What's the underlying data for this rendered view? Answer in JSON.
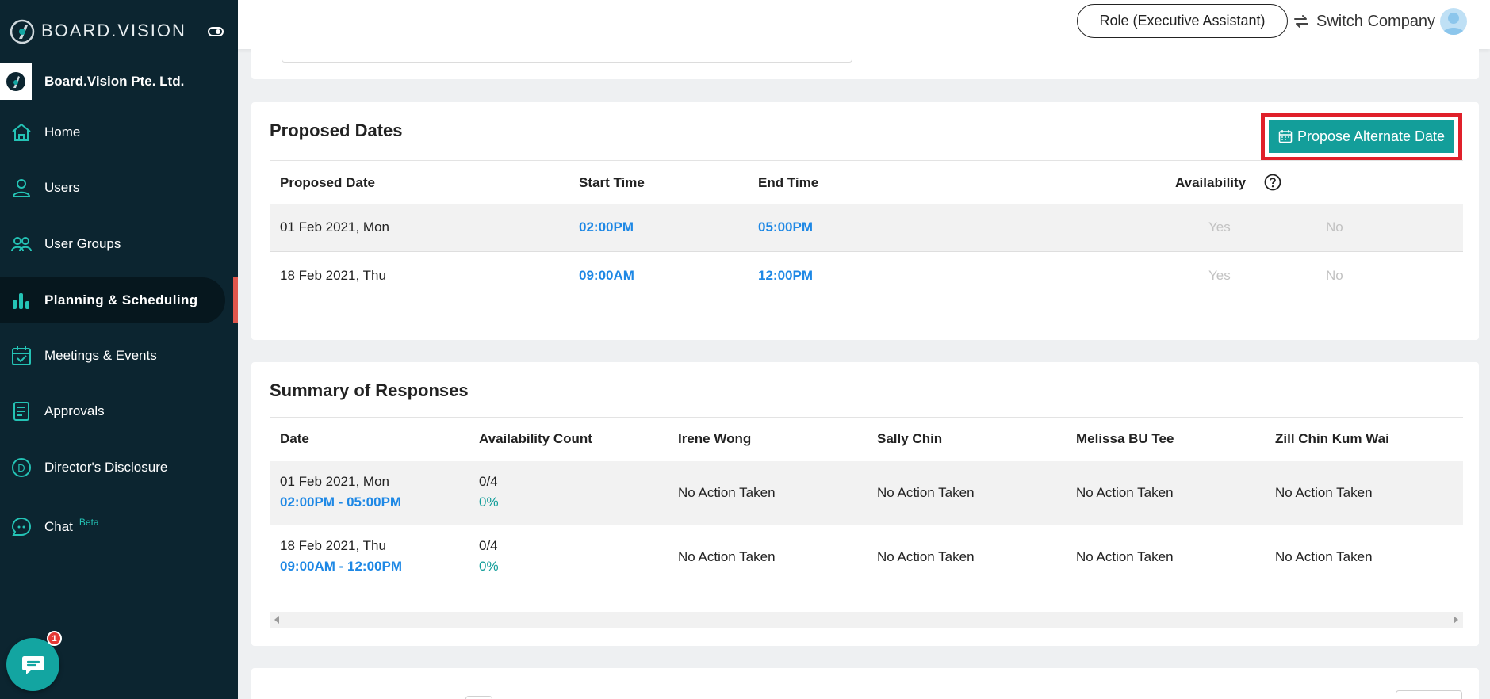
{
  "brand": {
    "name": "BOARD.VISION"
  },
  "company": {
    "name": "Board.Vision Pte. Ltd."
  },
  "sidebar": {
    "items": [
      {
        "label": "Home",
        "icon": "home-icon"
      },
      {
        "label": "Users",
        "icon": "user-icon"
      },
      {
        "label": "User Groups",
        "icon": "users-icon"
      },
      {
        "label": "Planning & Scheduling",
        "icon": "bar-chart-icon",
        "active": true
      },
      {
        "label": "Meetings & Events",
        "icon": "calendar-check-icon"
      },
      {
        "label": "Approvals",
        "icon": "document-icon"
      },
      {
        "label": "Director's Disclosure",
        "icon": "disclosure-icon"
      },
      {
        "label": "Chat",
        "icon": "chat-bubble-icon",
        "badge": "Beta"
      }
    ]
  },
  "chat_fab": {
    "badge_count": "1"
  },
  "header": {
    "role": "Role (Executive Assistant)",
    "switch_company": "Switch Company"
  },
  "proposed_dates": {
    "title": "Proposed Dates",
    "propose_button": "Propose Alternate Date",
    "columns": [
      "Proposed Date",
      "Start Time",
      "End Time",
      "Availability"
    ],
    "rows": [
      {
        "date": "01 Feb 2021, Mon",
        "start": "02:00PM",
        "end": "05:00PM",
        "yes": "Yes",
        "no": "No"
      },
      {
        "date": "18 Feb 2021, Thu",
        "start": "09:00AM",
        "end": "12:00PM",
        "yes": "Yes",
        "no": "No"
      }
    ]
  },
  "summary": {
    "title": "Summary of Responses",
    "columns": [
      "Date",
      "Availability Count",
      "Irene Wong",
      "Sally Chin",
      "Melissa BU Tee",
      "Zill Chin Kum Wai"
    ],
    "rows": [
      {
        "date": "01 Feb 2021, Mon",
        "time": "02:00PM - 05:00PM",
        "count": "0/4",
        "pct": "0%",
        "responses": [
          "No Action Taken",
          "No Action Taken",
          "No Action Taken",
          "No Action Taken"
        ]
      },
      {
        "date": "18 Feb 2021, Thu",
        "time": "09:00AM - 12:00PM",
        "count": "0/4",
        "pct": "0%",
        "responses": [
          "No Action Taken",
          "No Action Taken",
          "No Action Taken",
          "No Action Taken"
        ]
      }
    ]
  },
  "colors": {
    "sidebar": "#0c2530",
    "accent": "#139e9a",
    "time": "#1e88e5",
    "highlight": "#e0202a"
  }
}
